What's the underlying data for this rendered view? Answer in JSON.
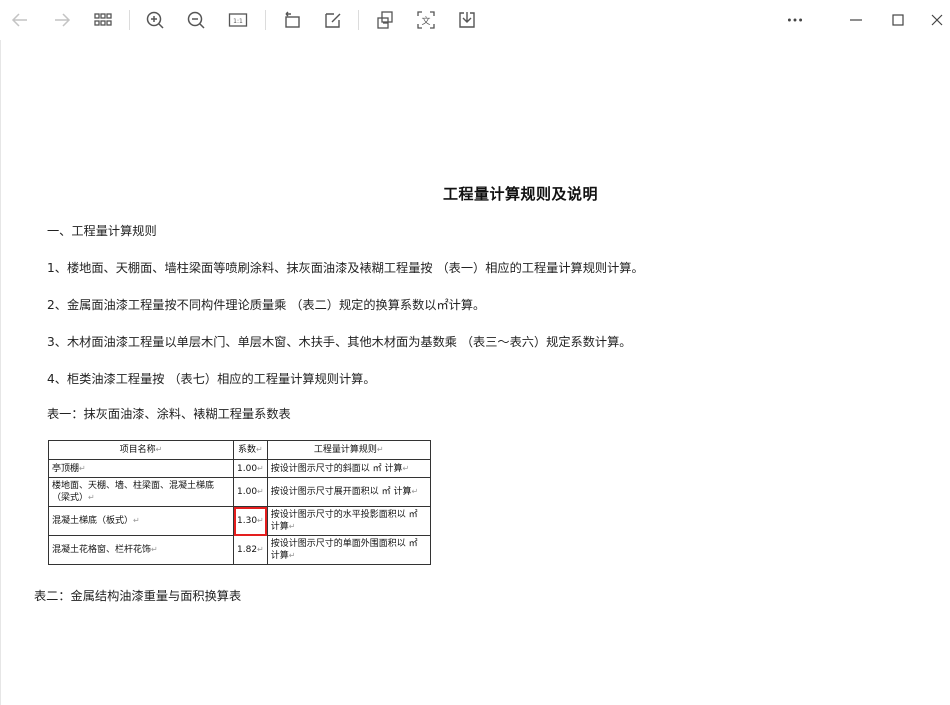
{
  "toolbar": {
    "buttons": [
      {
        "name": "back-button",
        "icon": "arrow-left-icon",
        "disabled": true
      },
      {
        "name": "forward-button",
        "icon": "arrow-right-icon",
        "disabled": true
      },
      {
        "name": "thumbnails-button",
        "icon": "grid-icon"
      },
      {
        "name": "zoom-in-button",
        "icon": "zoom-in-icon"
      },
      {
        "name": "zoom-out-button",
        "icon": "zoom-out-icon"
      },
      {
        "name": "actual-size-button",
        "icon": "actual-size-icon",
        "text": "1:1"
      },
      {
        "name": "rotate-button",
        "icon": "rotate-icon"
      },
      {
        "name": "edit-button",
        "icon": "edit-icon"
      },
      {
        "name": "crop-button",
        "icon": "crop-icon"
      },
      {
        "name": "ocr-button",
        "icon": "text-recognition-icon",
        "text": "文"
      },
      {
        "name": "save-button",
        "icon": "download-icon"
      },
      {
        "name": "more-button",
        "icon": "more-icon"
      }
    ]
  },
  "document": {
    "title": "工程量计算规则及说明",
    "section1": "一、工程量计算规则",
    "rule1": "1、楼地面、天棚面、墙柱梁面等喷刷涂料、抹灰面油漆及裱糊工程量按 （表一）相应的工程量计算规则计算。",
    "rule2": "2、金属面油漆工程量按不同构件理论质量乘 （表二）规定的换算系数以㎡计算。",
    "rule3": "3、木材面油漆工程量以单层木门、单层木窗、木扶手、其他木材面为基数乘 （表三～表六）规定系数计算。",
    "rule4": "4、柜类油漆工程量按 （表七）相应的工程量计算规则计算。",
    "table1_caption": "表一：抹灰面油漆、涂料、裱糊工程量系数表",
    "table2_caption": "表二：金属结构油漆重量与面积换算表",
    "table1": {
      "headers": [
        "项目名称",
        "系数",
        "工程量计算规则"
      ],
      "rows": [
        {
          "name": "亭顶棚",
          "coef": "1.00",
          "rule": "按设计图示尺寸的斜面以 ㎡ 计算"
        },
        {
          "name": "楼地面、天棚、墙、柱梁面、混凝土梯底（梁式）",
          "coef": "1.00",
          "rule": "按设计图示尺寸展开面积以 ㎡ 计算"
        },
        {
          "name": "混凝土梯底（板式）",
          "coef": "1.30",
          "rule": "按设计图示尺寸的水平投影面积以 ㎡ 计算"
        },
        {
          "name": "混凝土花格窗、栏杆花饰",
          "coef": "1.82",
          "rule": "按设计图示尺寸的单面外围面积以 ㎡ 计算"
        }
      ],
      "highlighted_cell": "1.30"
    }
  },
  "colors": {
    "highlight": "#e41e1e",
    "toolbar_icon": "#555555",
    "disabled_icon": "#c4c4c4"
  }
}
